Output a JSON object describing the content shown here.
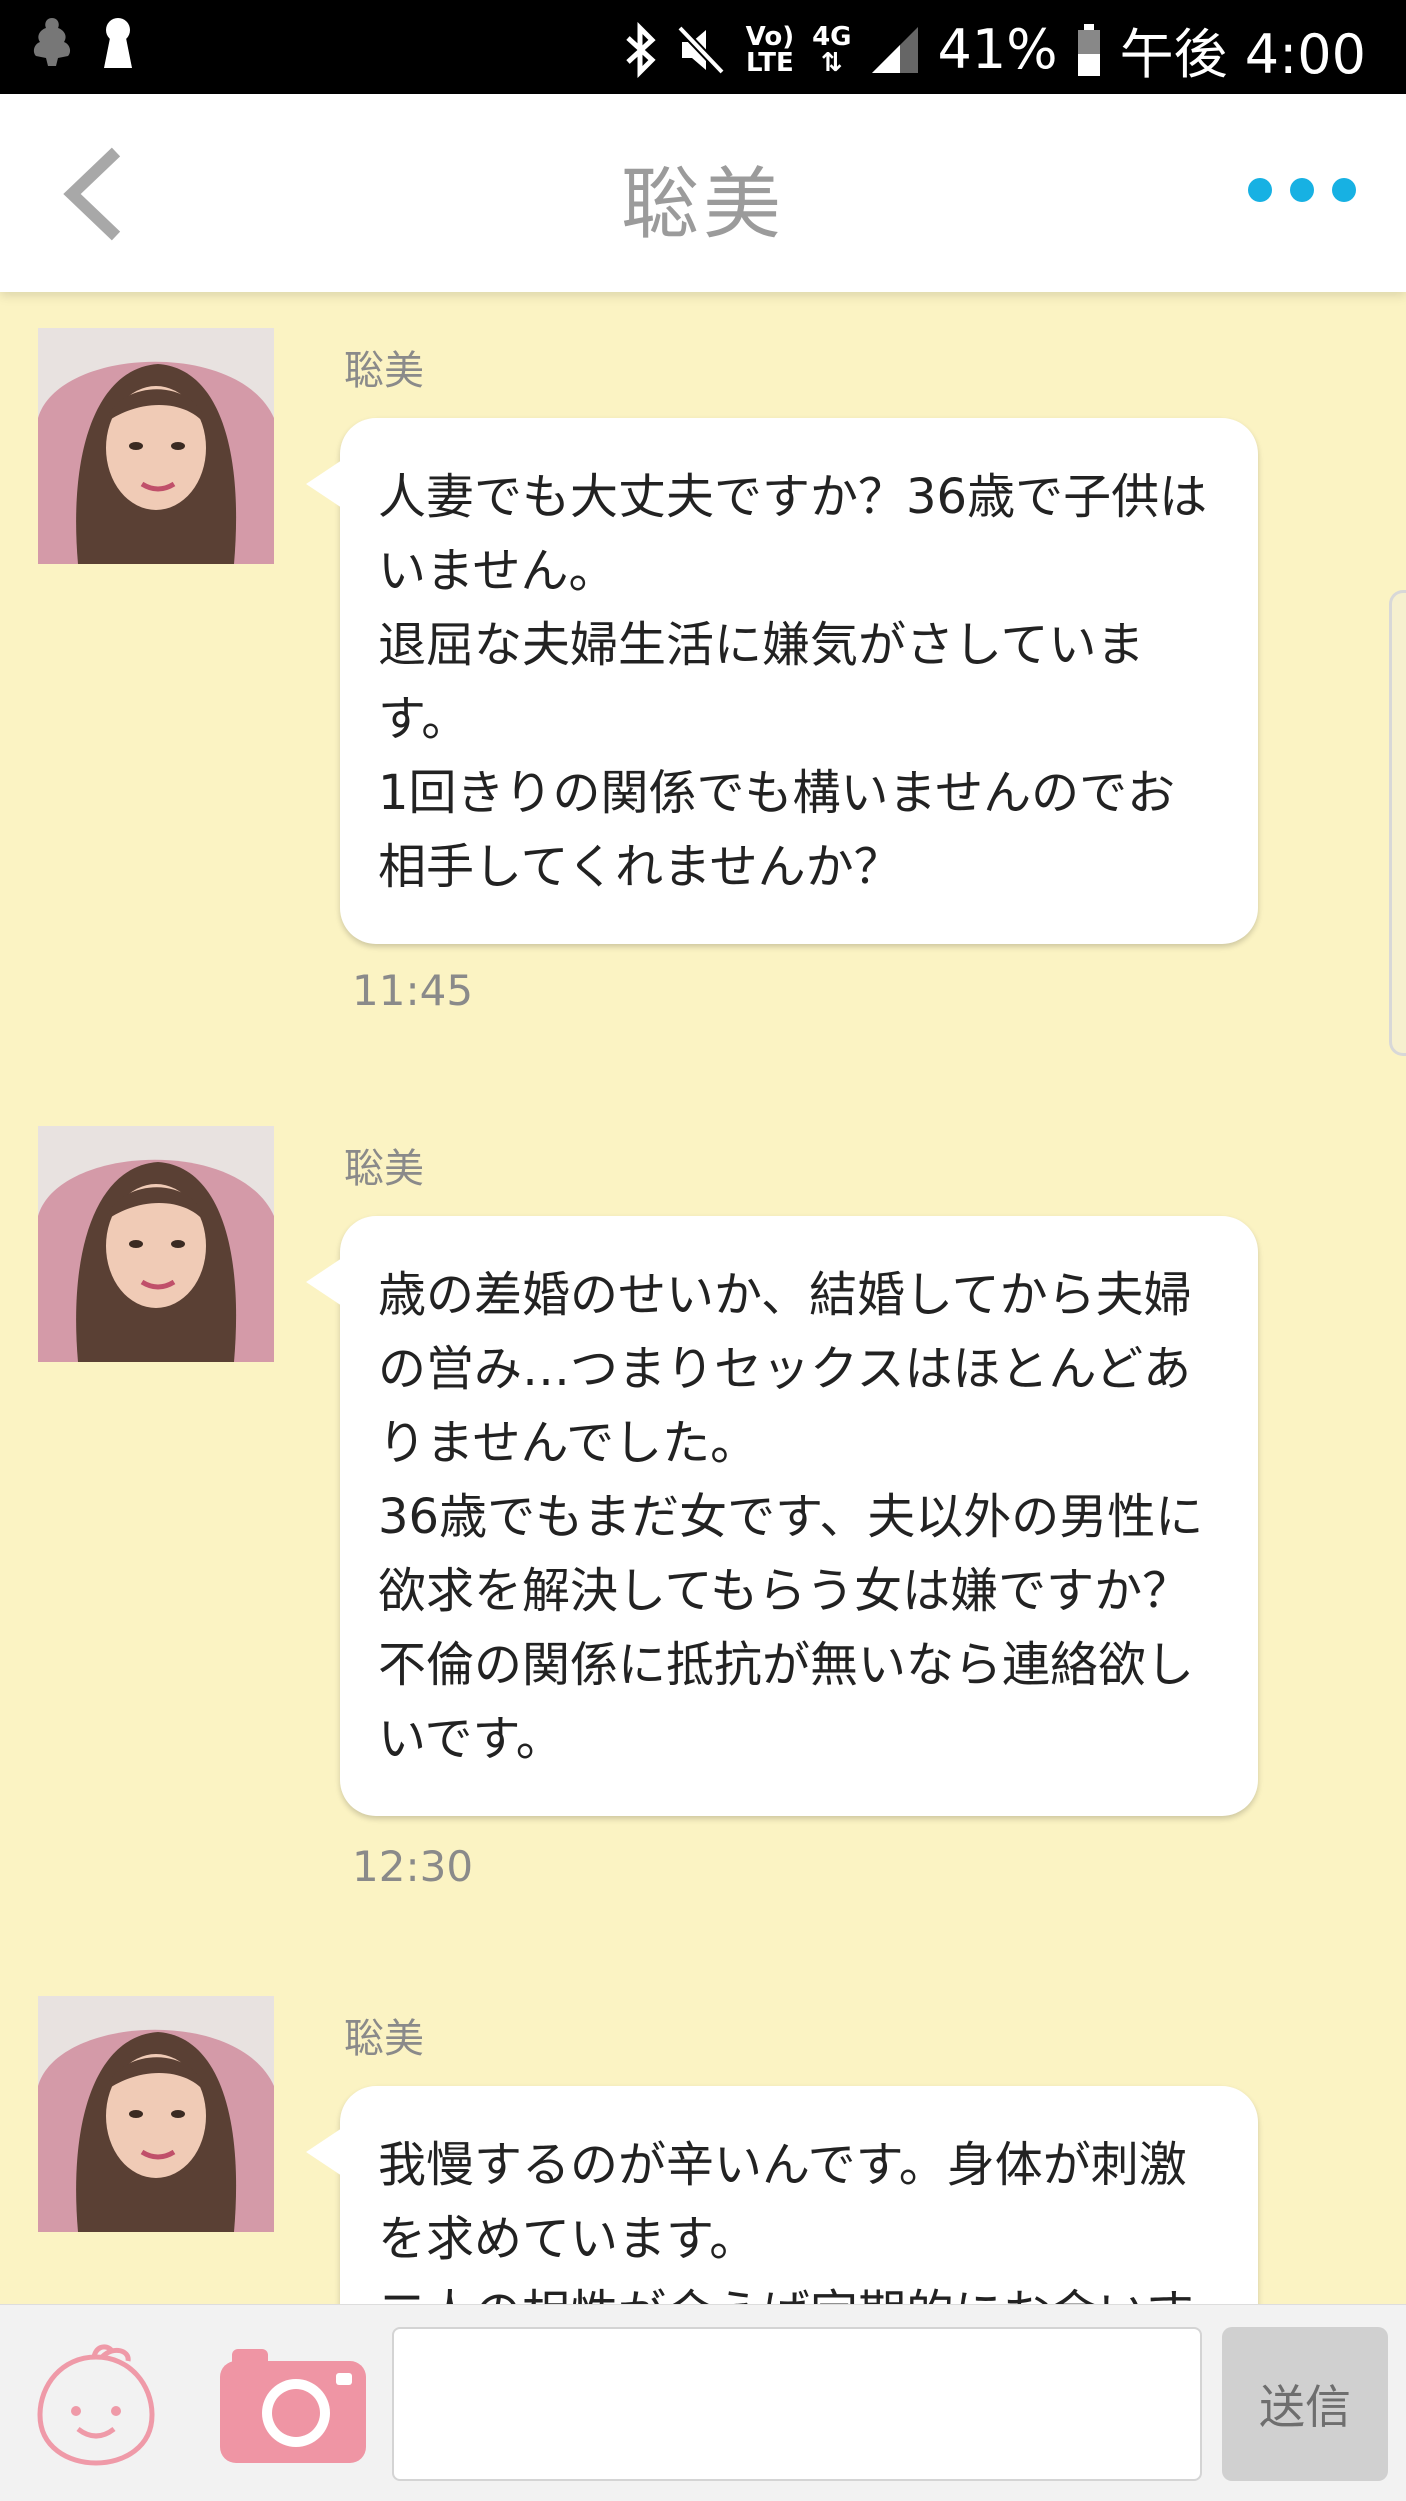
{
  "status_bar": {
    "signal_label_top": "Vo)",
    "signal_label_bottom": "LTE",
    "network": "4G",
    "battery": "41%",
    "time": "午後 4:00"
  },
  "header": {
    "title": "聡美",
    "accent_color": "#17b1e3"
  },
  "messages": [
    {
      "sender": "聡美",
      "text": "人妻でも大丈夫ですか？36歳で子供は\nいません。\n退屈な夫婦生活に嫌気がさしていま\nす。\n1回きりの関係でも構いませんのでお\n相手してくれませんか？",
      "time": "11:45"
    },
    {
      "sender": "聡美",
      "text": "歳の差婚のせいか、結婚してから夫婦\nの営み…つまりセックスはほとんどあ\nりませんでした。\n36歳でもまだ女です、夫以外の男性に\n欲求を解決してもらう女は嫌ですか？\n不倫の関係に抵抗が無いなら連絡欲し\nいです。",
      "time": "12:30"
    },
    {
      "sender": "聡美",
      "text": "我慢するのが辛いんです。身体が刺激\nを求めています。\n二人の相性が合えば定期的にお会いす",
      "time": ""
    }
  ],
  "compose": {
    "input_value": "",
    "send_label": "送信"
  }
}
